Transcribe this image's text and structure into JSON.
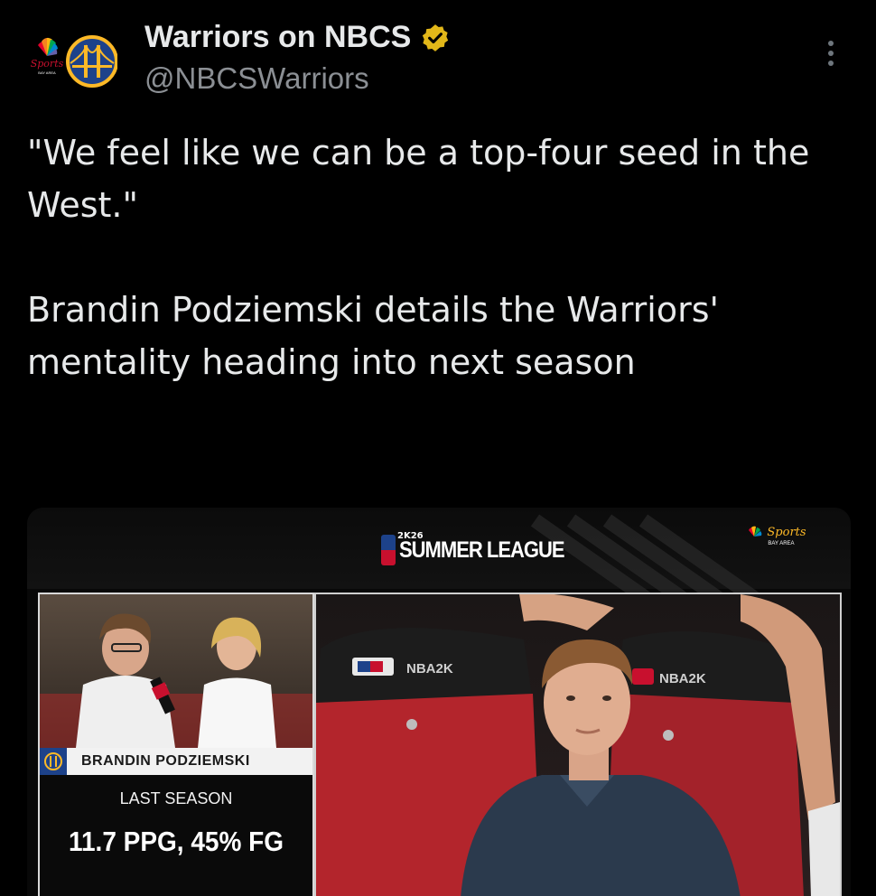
{
  "header": {
    "display_name": "Warriors on NBCS",
    "handle": "@NBCSWarriors",
    "avatar_brand": "Sports",
    "avatar_brand_sub": "BAY AREA"
  },
  "tweet": {
    "quote": "\"We feel like we can be a top-four seed in the West.\"",
    "body": "Brandin Podziemski details the Warriors' mentality heading into next season"
  },
  "media": {
    "event_logo": "SUMMER LEAGUE",
    "event_year": "2K26",
    "network_logo": "Sports",
    "network_logo_sub": "BAY AREA",
    "seat_brand_left": "NBA2K",
    "seat_brand_right": "NBA2K",
    "lower_third": {
      "player_name": "BRANDIN PODZIEMSKI",
      "label": "LAST SEASON",
      "stat": "11.7 PPG, 45% FG"
    }
  },
  "colors": {
    "background": "#000000",
    "text": "#e7e9ea",
    "secondary_text": "#8b8f94",
    "verified": "#e2b719",
    "warriors_blue": "#1d428a",
    "warriors_gold": "#fdb927"
  },
  "icons": [
    "nbc-peacock-icon",
    "warriors-logo-icon",
    "verified-badge-icon",
    "more-options-icon",
    "nba-logo-icon"
  ]
}
